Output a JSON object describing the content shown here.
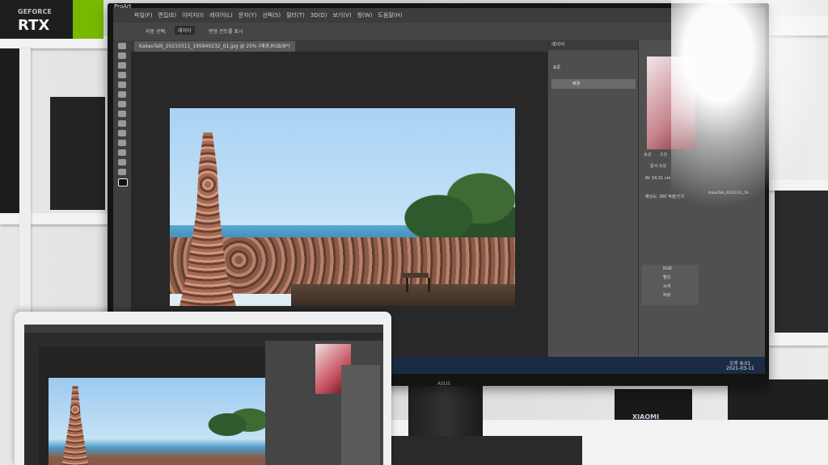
{
  "gpu_box": {
    "brand_top": "GEFORCE",
    "brand_bottom": "RTX"
  },
  "monitor": {
    "brand": "ProArt",
    "bezel_logo": "ASUS"
  },
  "photoshop": {
    "menu": [
      "파일(F)",
      "편집(E)",
      "이미지(I)",
      "레이어(L)",
      "문자(Y)",
      "선택(S)",
      "필터(T)",
      "3D(D)",
      "보기(V)",
      "창(W)",
      "도움말(H)"
    ],
    "options": {
      "auto_select": "자동 선택:",
      "layer_select": "레이어",
      "transform_controls": "변형 컨트롤 표시"
    },
    "document_tab": "KakaoTalk_20210311_195940232_01.jpg @ 25% (배경,RGB/8*)",
    "layers_panel": {
      "title": "레이어",
      "mode": "표준",
      "layer_name": "배경"
    },
    "properties_panel": {
      "tabs": [
        "속성",
        "조정"
      ],
      "doc_label": "문서 속성",
      "width": "W: 34.31 cm",
      "resolution": "해상도: 300 픽셀/인치"
    },
    "channels": [
      "RGB",
      "빨강",
      "녹색",
      "파랑"
    ],
    "history_item": "KakaoTalk_20210311_19..."
  },
  "taskbar": {
    "time": "오후 8:01",
    "date": "2021-03-11"
  },
  "boxes": {
    "xiaomi_label": "XIAOMI"
  }
}
